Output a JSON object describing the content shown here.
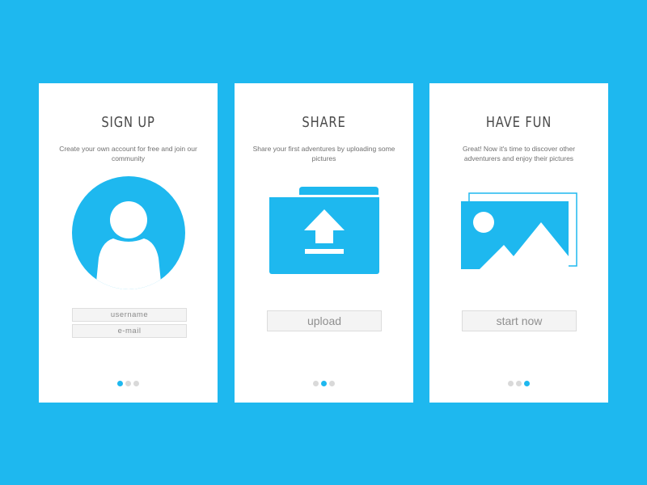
{
  "colors": {
    "background": "#1eb8ef",
    "card": "#ffffff",
    "accent": "#1eb8ef",
    "dot_inactive": "#d9d9d9"
  },
  "screens": [
    {
      "title": "SIGN UP",
      "subtitle": "Create your own account for free and join our community",
      "illustration": "user-avatar-icon",
      "fields": [
        {
          "placeholder": "username"
        },
        {
          "placeholder": "e-mail"
        }
      ],
      "pagination": {
        "active_index": 0,
        "count": 3
      }
    },
    {
      "title": "SHARE",
      "subtitle": "Share your first adventures by uploading some pictures",
      "illustration": "upload-folder-icon",
      "button_label": "upload",
      "pagination": {
        "active_index": 1,
        "count": 3
      }
    },
    {
      "title": "HAVE FUN",
      "subtitle": "Great! Now it's time to discover other adventurers and enjoy their pictures",
      "illustration": "picture-gallery-icon",
      "button_label": "start now",
      "pagination": {
        "active_index": 2,
        "count": 3
      }
    }
  ]
}
